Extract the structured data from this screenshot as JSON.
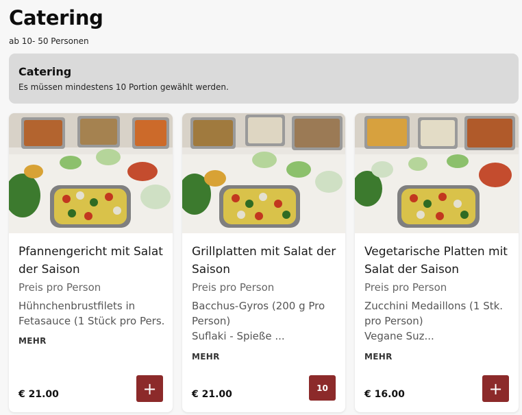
{
  "page": {
    "title": "Catering",
    "subtitle": "ab 10- 50 Personen"
  },
  "info": {
    "title": "Catering",
    "text": "Es müssen mindestens 10 Portion gewählt werden."
  },
  "colors": {
    "accent": "#8c2a2a",
    "info_bg": "#dadada"
  },
  "cards": [
    {
      "title": "Pfannengericht mit Salat der Saison",
      "subtitle": "Preis pro Person",
      "desc_lines": [
        "Hühnchenbrustfilets in",
        "Fetasauce (1 Stück pro Pers..."
      ],
      "more": "MEHR",
      "price": "€ 21.00",
      "action": "+",
      "action_icon": "plus-icon"
    },
    {
      "title": "Grillplatten mit Salat der Saison",
      "subtitle": "Preis pro Person",
      "desc_lines": [
        "Bacchus-Gyros (200 g Pro",
        "Person)",
        "Suflaki - Spieße ..."
      ],
      "more": "MEHR",
      "price": "€ 21.00",
      "action": "10"
    },
    {
      "title": "Vegetarische Platten mit Salat der Saison",
      "subtitle": "Preis pro Person",
      "desc_lines": [
        "Zucchini Medaillons (1 Stk.",
        "pro Person)",
        "Vegane Suz..."
      ],
      "more": "MEHR",
      "price": "€ 16.00",
      "action": "+",
      "action_icon": "plus-icon"
    }
  ]
}
